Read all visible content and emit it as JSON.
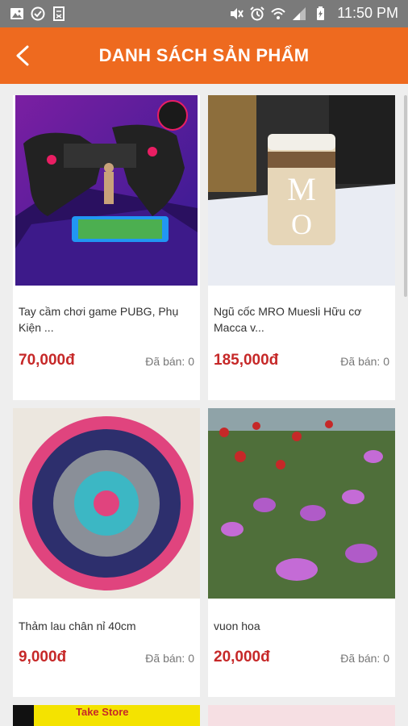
{
  "status_bar": {
    "time": "11:50 PM",
    "icons": [
      "image-icon",
      "check-circle-icon",
      "document-icon",
      "mute-icon",
      "alarm-icon",
      "wifi-icon",
      "signal-icon",
      "battery-icon"
    ]
  },
  "app_bar": {
    "title": "DANH SÁCH SẢN PHẨM",
    "back_icon": "chevron-left-icon",
    "color": "#ee6a1f"
  },
  "products": [
    {
      "name": "Tay cầm chơi game PUBG, Phụ Kiện ...",
      "price": "70,000đ",
      "sold": "Đã bán: 0",
      "image": "gamepad-photo"
    },
    {
      "name": "Ngũ cốc MRO Muesli Hữu cơ Macca v...",
      "price": "185,000đ",
      "sold": "Đã bán: 0",
      "image": "cereal-jar-photo"
    },
    {
      "name": "Thảm lau chân nỉ 40cm",
      "price": "9,000đ",
      "sold": "Đã bán: 0",
      "image": "round-rug-photo"
    },
    {
      "name": "vuon hoa",
      "price": "20,000đ",
      "sold": "Đã bán: 0",
      "image": "flower-garden-photo"
    }
  ],
  "partial_banner_text": "Take Store",
  "colors": {
    "accent": "#ee6a1f",
    "price": "#c62828"
  }
}
